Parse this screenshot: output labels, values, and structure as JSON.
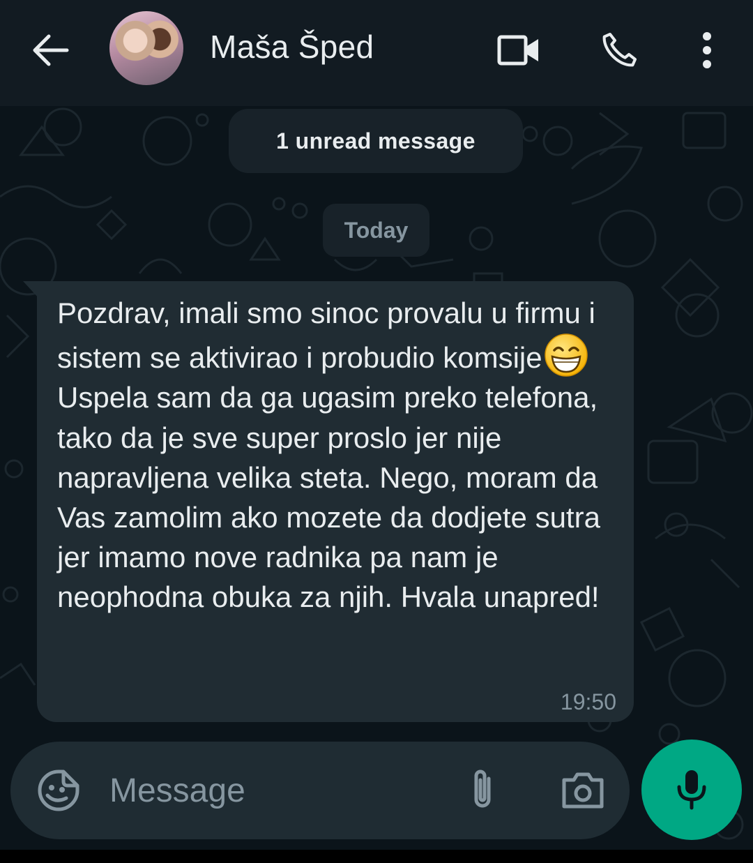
{
  "header": {
    "contact_name": "Maša Šped",
    "icons": {
      "back": "arrow-left-icon",
      "video": "video-camera-icon",
      "call": "phone-icon",
      "menu": "more-vertical-icon"
    }
  },
  "chat": {
    "unread_banner": "1 unread message",
    "date_divider": "Today",
    "messages": [
      {
        "paragraph1": "Pozdrav, imali smo sinoc provalu u firmu i sistem se aktivirao i probudio komsije",
        "emoji": "grinning-face-with-smiling-eyes",
        "paragraph2": "Uspela sam da ga ugasim preko telefona, tako da je sve super proslo jer nije napravljena velika steta. Nego, moram da Vas zamolim ako mozete da dodjete sutra jer imamo nove radnika pa nam je neophodna obuka za njih. Hvala unapred!",
        "time": "19:50"
      }
    ]
  },
  "composer": {
    "placeholder": "Message",
    "value": "",
    "icons": {
      "emoji": "sticker-smiley-icon",
      "attach": "paperclip-icon",
      "camera": "camera-icon",
      "mic": "microphone-icon"
    }
  },
  "colors": {
    "background": "#0b141a",
    "header": "#121b22",
    "bubble": "#202c33",
    "accent": "#00a884",
    "muted_text": "#8696a0"
  }
}
